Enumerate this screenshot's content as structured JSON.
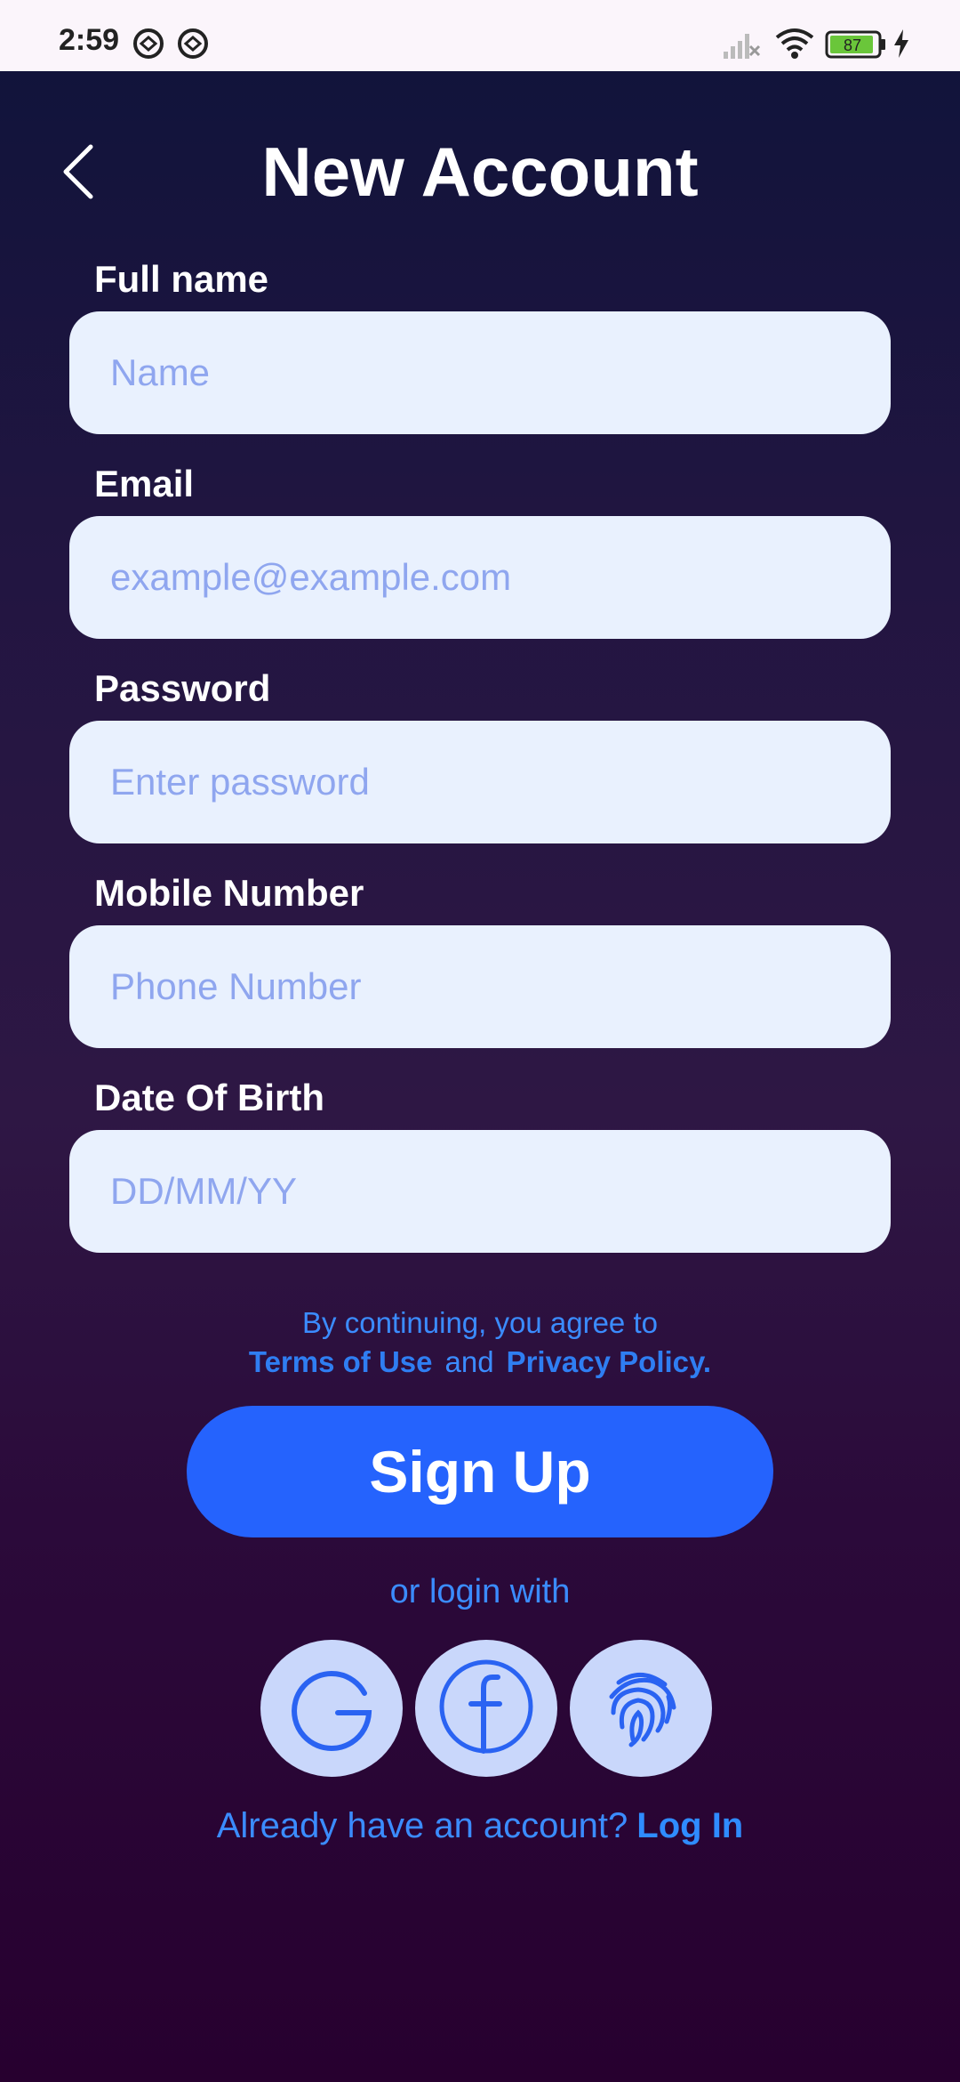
{
  "status_bar": {
    "time": "2:59",
    "battery_level": "87",
    "icons": [
      "notification-icon",
      "notification-icon",
      "signal-icon",
      "wifi-icon",
      "battery-icon",
      "charging-icon"
    ]
  },
  "header": {
    "title": "New Account",
    "back_icon": "chevron-left-icon"
  },
  "form": {
    "full_name": {
      "label": "Full name",
      "placeholder": "Name",
      "value": ""
    },
    "email": {
      "label": "Email",
      "placeholder": "example@example.com",
      "value": ""
    },
    "password": {
      "label": "Password",
      "placeholder": "Enter password",
      "value": ""
    },
    "mobile": {
      "label": "Mobile Number",
      "placeholder": "Phone Number",
      "value": ""
    },
    "dob": {
      "label": "Date Of Birth",
      "placeholder": "DD/MM/YY",
      "value": ""
    }
  },
  "terms": {
    "line1": "By continuing, you agree to",
    "terms_link": "Terms of Use",
    "and": "and",
    "privacy_link": "Privacy Policy."
  },
  "signup_button": "Sign Up",
  "or_login_with": "or login with",
  "social": [
    {
      "name": "google",
      "icon": "google-icon"
    },
    {
      "name": "facebook",
      "icon": "facebook-icon"
    },
    {
      "name": "fingerprint",
      "icon": "fingerprint-icon"
    }
  ],
  "footer": {
    "already": "Already have an account?",
    "login_link": "Log In"
  },
  "colors": {
    "accent": "#2563fd",
    "link": "#3b8cff",
    "field_bg": "#e9f1fe",
    "placeholder": "#8fa6ef",
    "social_bg": "#c9d7fb"
  }
}
